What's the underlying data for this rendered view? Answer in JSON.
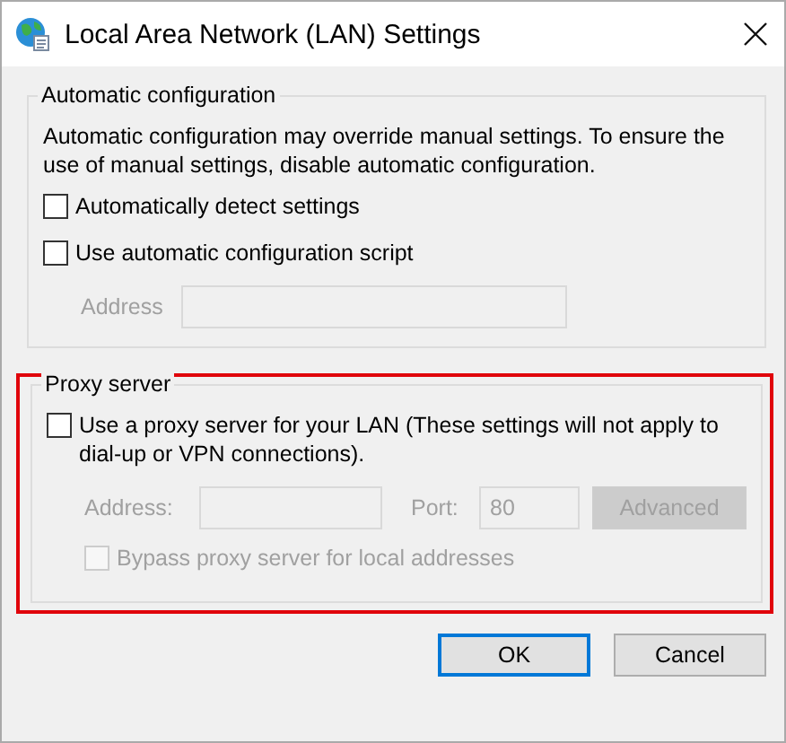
{
  "window": {
    "title": "Local Area Network (LAN) Settings"
  },
  "automatic_configuration": {
    "legend": "Automatic configuration",
    "description": "Automatic configuration may override manual settings.  To ensure the use of manual settings, disable automatic configuration.",
    "checkboxes": [
      {
        "label": "Automatically detect settings",
        "checked": false
      },
      {
        "label": "Use automatic configuration script",
        "checked": false
      }
    ],
    "address": {
      "label": "Address",
      "disabled": true
    }
  },
  "proxy_server": {
    "legend": "Proxy server",
    "highlighted": true,
    "use_proxy": {
      "label": "Use a proxy server for your LAN (These settings will not apply to dial-up or VPN connections).",
      "checked": false
    },
    "address": {
      "label": "Address:",
      "disabled": true
    },
    "port": {
      "label": "Port:",
      "value": "80",
      "disabled": true
    },
    "advanced_button": {
      "label": "Advanced",
      "disabled": true
    },
    "bypass": {
      "label": "Bypass proxy server for local addresses",
      "checked": false,
      "disabled": true
    }
  },
  "buttons": [
    {
      "label": "OK",
      "default": true
    },
    {
      "label": "Cancel",
      "default": false
    }
  ]
}
